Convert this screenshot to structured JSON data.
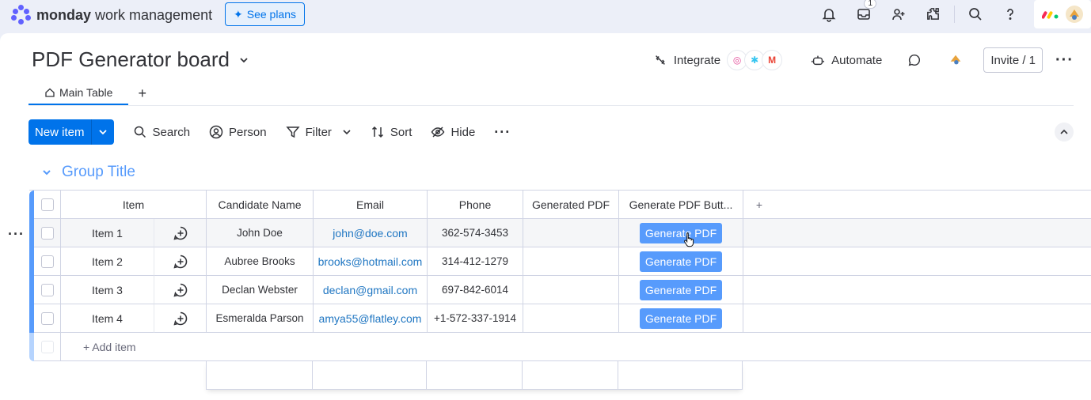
{
  "topbar": {
    "brand_bold": "monday",
    "brand_rest": " work management",
    "see_plans": "See plans",
    "inbox_badge": "1",
    "icons": [
      "bell-icon",
      "inbox-icon",
      "invite-user-icon",
      "apps-icon",
      "search-icon",
      "help-icon"
    ]
  },
  "board": {
    "title": "PDF Generator board",
    "integrate": "Integrate",
    "automate": "Automate",
    "invite": "Invite / 1"
  },
  "tabs": [
    {
      "label": "Main Table"
    }
  ],
  "toolbar": {
    "new_item": "New item",
    "search": "Search",
    "person": "Person",
    "filter": "Filter",
    "sort": "Sort",
    "hide": "Hide"
  },
  "group": {
    "title": "Group Title",
    "color": "#579bfc"
  },
  "table": {
    "columns": [
      "Item",
      "Candidate Name",
      "Email",
      "Phone",
      "Generated PDF",
      "Generate PDF Butt..."
    ],
    "rows": [
      {
        "item": "Item 1",
        "name": "John Doe",
        "email": "john@doe.com",
        "phone": "362-574-3453",
        "pdf": "",
        "button": "Generate PDF"
      },
      {
        "item": "Item 2",
        "name": "Aubree Brooks",
        "email": "brooks@hotmail.com",
        "phone": "314-412-1279",
        "pdf": "",
        "button": "Generate PDF"
      },
      {
        "item": "Item 3",
        "name": "Declan Webster",
        "email": "declan@gmail.com",
        "phone": "697-842-6014",
        "pdf": "",
        "button": "Generate PDF"
      },
      {
        "item": "Item 4",
        "name": "Esmeralda Parson",
        "email": "amya55@flatley.com",
        "phone": "+1-572-337-1914",
        "pdf": "",
        "button": "Generate PDF"
      }
    ],
    "add_item": "+ Add item"
  },
  "colors": {
    "primary": "#0073ea",
    "button": "#579bfc",
    "link": "#1f76c2"
  }
}
